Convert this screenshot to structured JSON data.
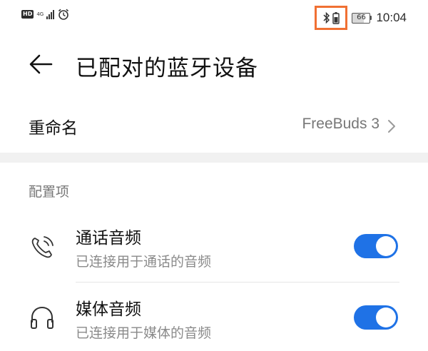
{
  "status_bar": {
    "hd_badge": "HD",
    "network_type": "4G",
    "network_sub": "46",
    "battery_level": "66",
    "time": "10:04",
    "highlight_color": "#f07033"
  },
  "header": {
    "title": "已配对的蓝牙设备",
    "back_icon": "back-arrow-icon"
  },
  "rename": {
    "label": "重命名",
    "value": "FreeBuds 3"
  },
  "profiles": {
    "section_title": "配置项",
    "items": [
      {
        "title": "通话音频",
        "subtitle": "已连接用于通话的音频",
        "icon": "phone-icon",
        "enabled": true
      },
      {
        "title": "媒体音频",
        "subtitle": "已连接用于媒体的音频",
        "icon": "headphones-icon",
        "enabled": true
      }
    ]
  },
  "colors": {
    "toggle_on": "#1f72e6",
    "section_gap": "#f1f1f1"
  }
}
